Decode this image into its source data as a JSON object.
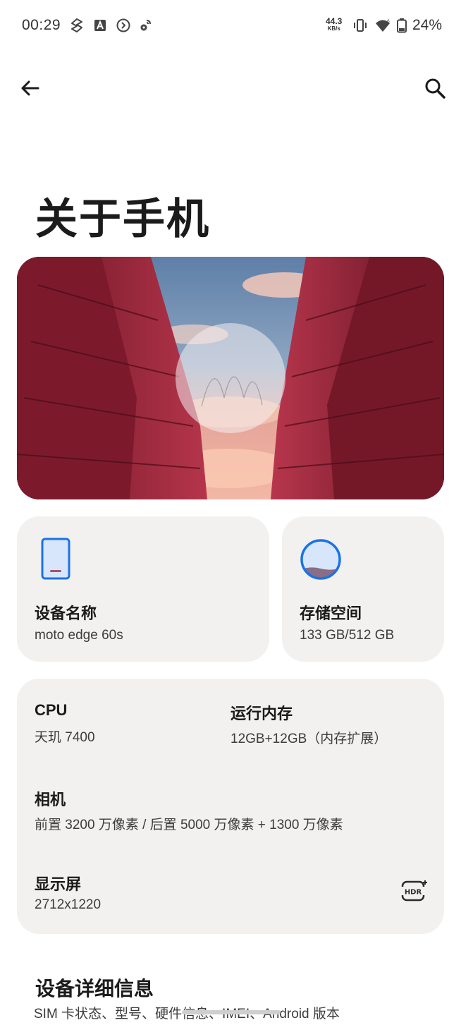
{
  "status_bar": {
    "time": "00:29",
    "net_speed_value": "44.3",
    "net_speed_unit": "KB/s",
    "battery": "24%",
    "icons": [
      "s-app-icon",
      "a-app-icon",
      "circle-arrow-icon",
      "gear-cloud-icon",
      "net-speed-icon",
      "vibrate-icon",
      "wifi-icon",
      "battery-icon"
    ]
  },
  "nav": {
    "back_icon": "back-arrow-icon",
    "search_icon": "search-icon"
  },
  "page_title": "关于手机",
  "hero": {
    "description": "wallpaper-hero-image"
  },
  "device_card": {
    "label": "设备名称",
    "value": "moto edge 60s",
    "icon": "phone-icon"
  },
  "storage_card": {
    "label": "存储空间",
    "value": "133 GB/512 GB",
    "icon": "storage-circle-icon",
    "used_fraction": 0.26
  },
  "specs": {
    "cpu_label": "CPU",
    "cpu_value": "天玑 7400",
    "ram_label": "运行内存",
    "ram_value": "12GB+12GB（内存扩展）",
    "camera_label": "相机",
    "camera_value": "前置 3200 万像素 / 后置 5000 万像素 + 1300 万像素",
    "display_label": "显示屏",
    "display_value": "2712x1220",
    "hdr_icon": "hdr-plus-icon"
  },
  "details": {
    "title": "设备详细信息",
    "subtitle": "SIM 卡状态、型号、硬件信息、IMEI、Android 版本"
  },
  "colors": {
    "accent": "#1a73e8",
    "card_bg": "#f2f1f0",
    "hero_red": "#a3283d",
    "sky": "#6f8fb4"
  }
}
